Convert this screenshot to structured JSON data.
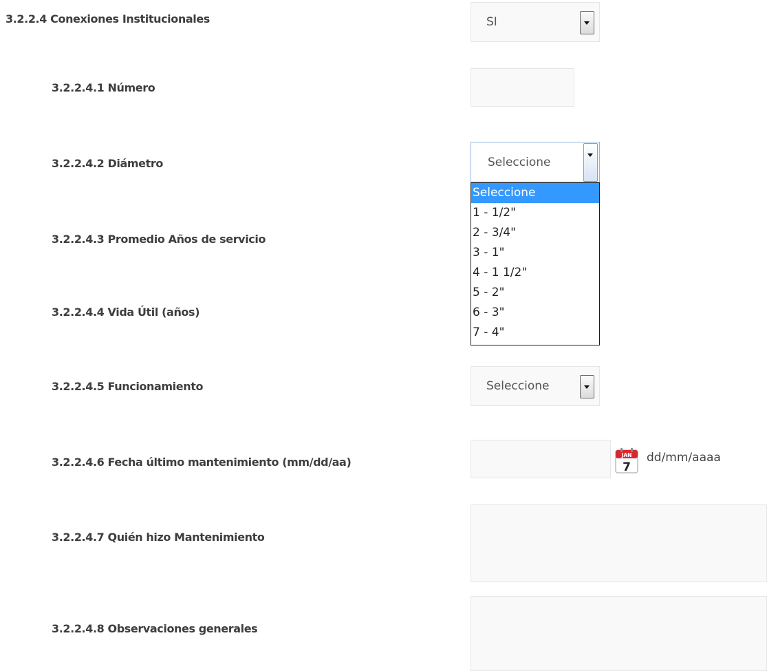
{
  "form": {
    "section_title": "3.2.2.4 Conexiones Institucionales",
    "section_value": "SI",
    "numero_label": "3.2.2.4.1 Número",
    "numero_value": "",
    "diametro_label": "3.2.2.4.2 Diámetro",
    "diametro_value": "Seleccione",
    "diametro_options": [
      "Seleccione",
      "1 - 1/2\"",
      "2 - 3/4\"",
      "3 - 1\"",
      "4 - 1 1/2\"",
      "5 - 2\"",
      "6 - 3\"",
      "7 - 4\""
    ],
    "promedio_label": "3.2.2.4.3 Promedio Años de servicio",
    "vida_label": "3.2.2.4.4 Vida Útil (años)",
    "funcionamiento_label": "3.2.2.4.5 Funcionamiento",
    "funcionamiento_value": "Seleccione",
    "fecha_label": "3.2.2.4.6 Fecha último mantenimiento (mm/dd/aa)",
    "fecha_value": "",
    "fecha_format_hint": "dd/mm/aaaa",
    "calendar_month": "JAN",
    "calendar_day": "7",
    "quien_label": "3.2.2.4.7 Quién hizo Mantenimiento",
    "quien_value": "",
    "observaciones_label": "3.2.2.4.8 Observaciones generales",
    "observaciones_value": ""
  },
  "colors": {
    "dropdown_highlight": "#3399ff",
    "field_background": "#f9f9f9",
    "label_text": "#3e3e3e",
    "calendar_red": "#d9272e"
  },
  "icons": {
    "calendar": "calendar-icon",
    "select_arrow": "chevron-down-icon"
  }
}
